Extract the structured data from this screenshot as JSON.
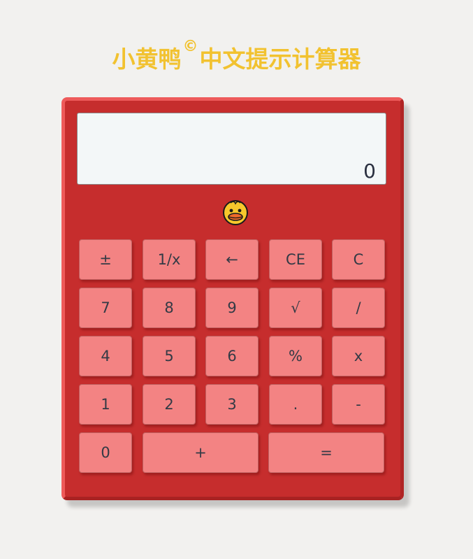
{
  "title": {
    "prefix": "小黄鸭",
    "copyright": "©",
    "suffix": "中文提示计算器"
  },
  "display": {
    "value": "0"
  },
  "mascot": "duck-icon",
  "keys": {
    "plus_minus": "±",
    "reciprocal": "1/x",
    "backspace": "←",
    "clear_entry": "CE",
    "clear": "C",
    "seven": "7",
    "eight": "8",
    "nine": "9",
    "sqrt": "√",
    "divide": "/",
    "four": "4",
    "five": "5",
    "six": "6",
    "percent": "%",
    "multiply": "x",
    "one": "1",
    "two": "2",
    "three": "3",
    "decimal": ".",
    "minus": "-",
    "zero": "0",
    "plus": "+",
    "equals": "="
  },
  "colors": {
    "title": "#f2c230",
    "body": "#c62d2d",
    "key": "#f38383",
    "display": "#f3f7f8"
  }
}
